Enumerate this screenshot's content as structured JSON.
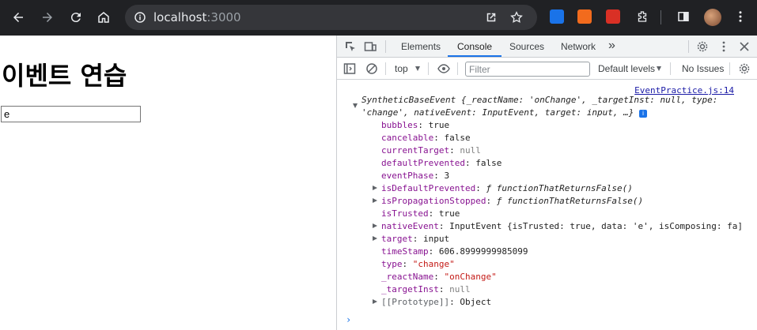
{
  "browser": {
    "url_host": "localhost",
    "url_port": ":3000"
  },
  "page": {
    "heading": "이벤트 연습",
    "input_value": "e"
  },
  "devtools": {
    "tabs": [
      "Elements",
      "Console",
      "Sources",
      "Network"
    ],
    "active_tab": "Console",
    "more_tabs": "»",
    "context": "top",
    "filter_placeholder": "Filter",
    "levels": "Default levels",
    "issues": "No Issues"
  },
  "console": {
    "source_link": "EventPractice.js:14",
    "summary_line1": "SyntheticBaseEvent {_reactName: 'onChange', _targetInst: null, type:",
    "summary_line2": "'change', nativeEvent: InputEvent, target: input, …}",
    "props": [
      {
        "key": "bubbles",
        "value": "true",
        "kind": "plain",
        "expand": false
      },
      {
        "key": "cancelable",
        "value": "false",
        "kind": "plain",
        "expand": false
      },
      {
        "key": "currentTarget",
        "value": "null",
        "kind": "null",
        "expand": false
      },
      {
        "key": "defaultPrevented",
        "value": "false",
        "kind": "plain",
        "expand": false
      },
      {
        "key": "eventPhase",
        "value": "3",
        "kind": "plain",
        "expand": false
      },
      {
        "key": "isDefaultPrevented",
        "value": "ƒ functionThatReturnsFalse()",
        "kind": "fn",
        "expand": true
      },
      {
        "key": "isPropagationStopped",
        "value": "ƒ functionThatReturnsFalse()",
        "kind": "fn",
        "expand": true
      },
      {
        "key": "isTrusted",
        "value": "true",
        "kind": "plain",
        "expand": false
      },
      {
        "key": "nativeEvent",
        "value": "InputEvent {isTrusted: true, data: 'e', isComposing: fa]",
        "kind": "obj",
        "expand": true
      },
      {
        "key": "target",
        "value": "input",
        "kind": "plain",
        "expand": true
      },
      {
        "key": "timeStamp",
        "value": "606.8999999985099",
        "kind": "plain",
        "expand": false
      },
      {
        "key": "type",
        "value": "\"change\"",
        "kind": "str",
        "expand": false
      },
      {
        "key": "_reactName",
        "value": "\"onChange\"",
        "kind": "str",
        "expand": false
      },
      {
        "key": "_targetInst",
        "value": "null",
        "kind": "null",
        "expand": false
      },
      {
        "key": "[[Prototype]]",
        "value": "Object",
        "kind": "proto",
        "expand": true
      }
    ],
    "prompt": "›"
  },
  "colors": {
    "browser_bar": "#202124",
    "accent": "#1a73e8",
    "prop_key": "#881391",
    "string": "#c41a16"
  }
}
